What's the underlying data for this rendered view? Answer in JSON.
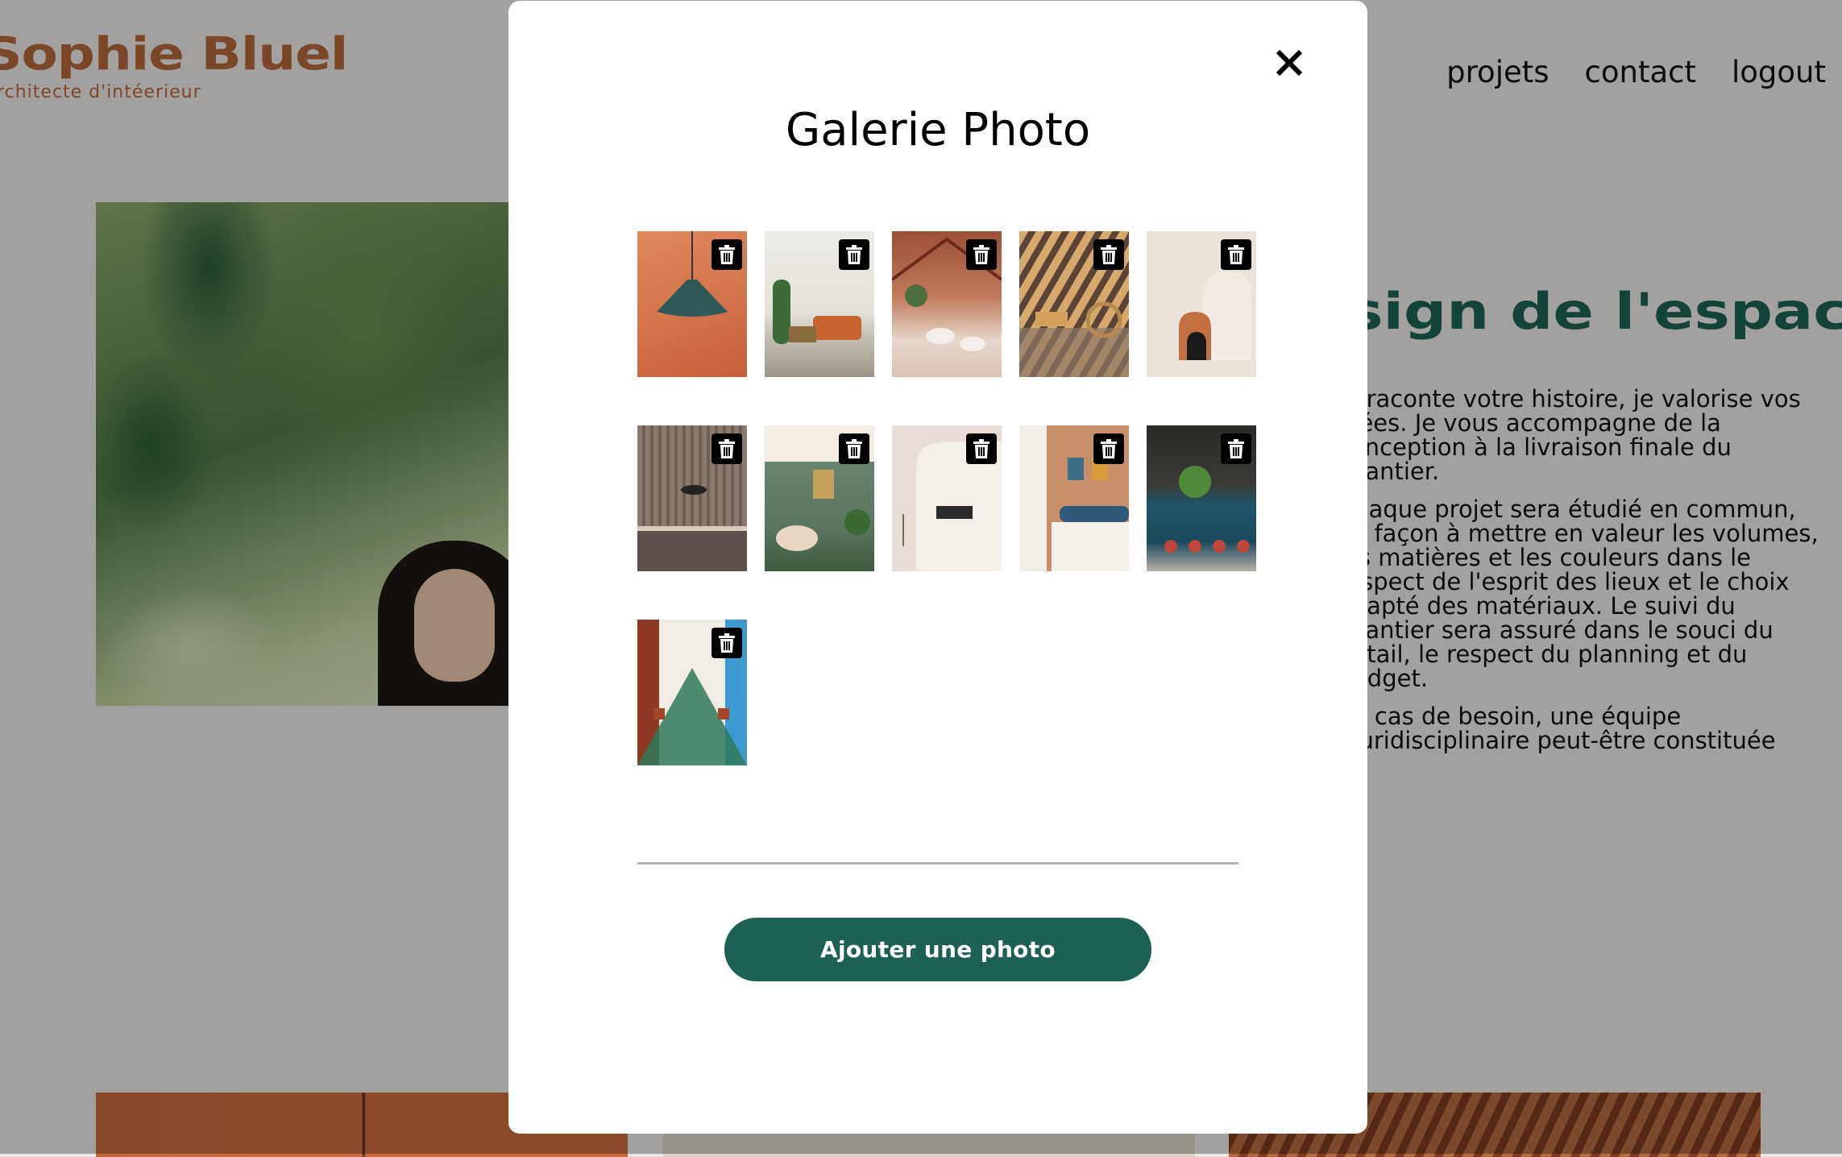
{
  "site": {
    "brand_name": "Sophie Bluel",
    "brand_tagline": "Architecte d'intéerieur",
    "nav": [
      "projets",
      "contact",
      "logout"
    ]
  },
  "about": {
    "title": "Design de l'espace",
    "paragraphs": [
      "Je raconte votre histoire, je valorise vos idées. Je vous accompagne de la conception à la livraison finale du chantier.",
      "Chaque projet sera étudié en commun, de façon à mettre en valeur les volumes, les matières et les couleurs dans le respect de l'esprit des lieux et le choix adapté des matériaux. Le suivi du chantier sera assuré dans le souci du détail, le respect du planning et du budget.",
      "En cas de besoin, une équipe pluridisciplinaire peut-être constituée"
    ]
  },
  "modal": {
    "title": "Galerie Photo",
    "add_button": "Ajouter une photo",
    "photos": [
      {
        "icon": "pendant-lamp-photo"
      },
      {
        "icon": "living-room-photo"
      },
      {
        "icon": "restaurant-photo"
      },
      {
        "icon": "sunlit-lounge-photo"
      },
      {
        "icon": "arches-decor-photo"
      },
      {
        "icon": "kitchen-photo"
      },
      {
        "icon": "green-living-room-photo"
      },
      {
        "icon": "white-alcove-photo"
      },
      {
        "icon": "bedroom-photo"
      },
      {
        "icon": "bar-photo"
      },
      {
        "icon": "dining-hall-photo"
      }
    ]
  },
  "colors": {
    "brand": "#b1663c",
    "accent": "#1d6154",
    "overlay": "rgba(0,0,0,0.30)"
  }
}
